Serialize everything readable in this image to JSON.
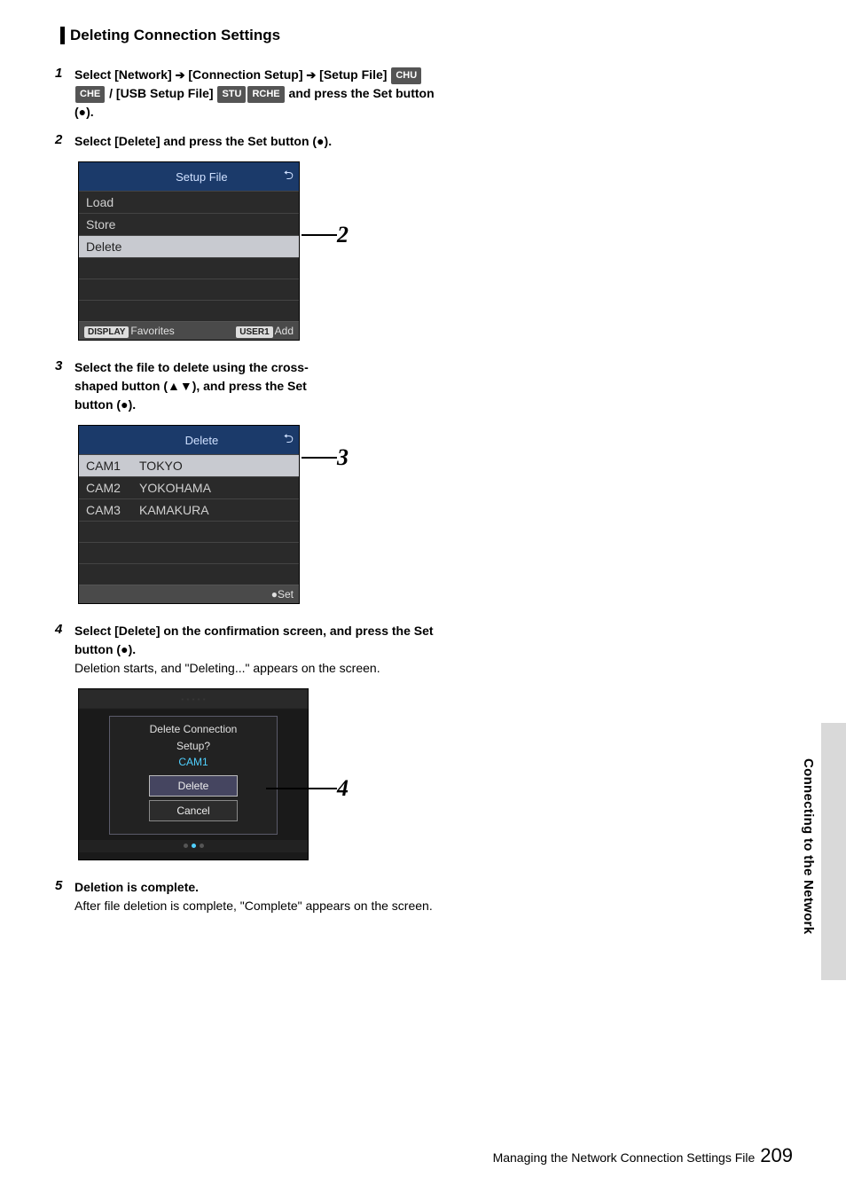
{
  "heading": "Deleting Connection Settings",
  "steps": {
    "s1": {
      "num": "1",
      "parts": {
        "a": "Select [Network] ",
        "b": " [Connection Setup] ",
        "c": " [Setup File]",
        "d": " / [USB Setup File]",
        "e": " and press the Set button (",
        "f": ")."
      },
      "badges": {
        "chu": "CHU",
        "che": "CHE",
        "stu": "STU",
        "rche": "RCHE"
      }
    },
    "s2": {
      "num": "2",
      "text": "Select [Delete] and press the Set button (",
      "text2": ")."
    },
    "s3": {
      "num": "3",
      "l1": "Select the file to delete using the cross-",
      "l2": "shaped button (▲▼), and press the Set",
      "l3": "button (",
      "l4": ")."
    },
    "s4": {
      "num": "4",
      "bold": "Select [Delete] on the confirmation screen, and press the Set button (",
      "bold2": ").",
      "body": "Deletion starts, and \"Deleting...\" appears on the screen."
    },
    "s5": {
      "num": "5",
      "bold": "Deletion is complete.",
      "body": "After file deletion is complete, \"Complete\" appears on the screen."
    }
  },
  "shot_setup": {
    "title": "Setup File",
    "rows": [
      "Load",
      "Store",
      "Delete"
    ],
    "footer": {
      "k1": "DISPLAY",
      "l1": "Favorites",
      "k2": "USER1",
      "l2": "Add"
    }
  },
  "shot_delete": {
    "title": "Delete",
    "rows": [
      {
        "c1": "CAM1",
        "c2": "TOKYO"
      },
      {
        "c1": "CAM2",
        "c2": "YOKOHAMA"
      },
      {
        "c1": "CAM3",
        "c2": "KAMAKURA"
      }
    ],
    "footer_right": "●Set"
  },
  "shot_confirm": {
    "msg1": "Delete Connection",
    "msg2": "Setup?",
    "cam": "CAM1",
    "btn_delete": "Delete",
    "btn_cancel": "Cancel"
  },
  "callouts": {
    "c2": "2",
    "c3": "3",
    "c4": "4"
  },
  "side_label": "Connecting to the Network",
  "footer": {
    "text": "Managing the Network Connection Settings File",
    "page": "209"
  }
}
